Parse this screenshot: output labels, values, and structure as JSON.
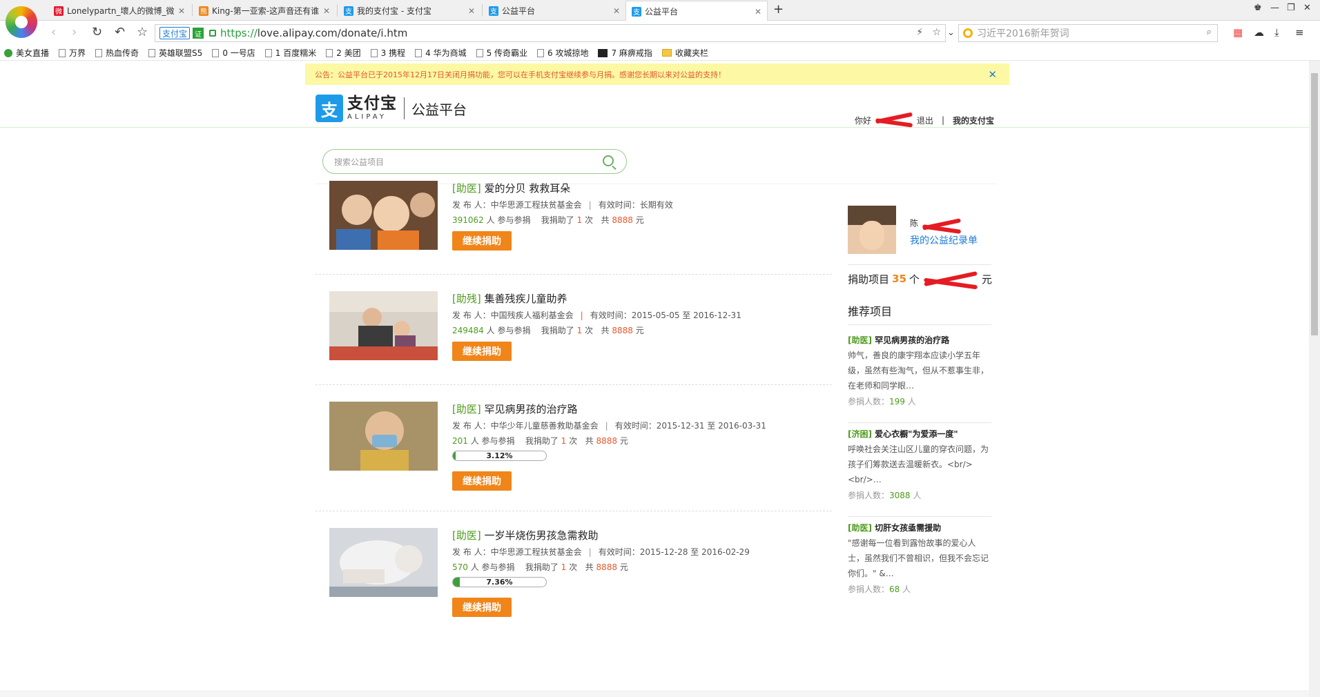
{
  "browser": {
    "tabs": [
      {
        "title": "Lonelypartn_壞人的微博_微",
        "color": "#e6162d",
        "active": false
      },
      {
        "title": "King-第一亚索-这声音还有谁",
        "color": "#f08519",
        "active": false
      },
      {
        "title": "我的支付宝  -  支付宝",
        "color": "#1e9be8",
        "active": false
      },
      {
        "title": "公益平台",
        "color": "#1e9be8",
        "active": false
      },
      {
        "title": "公益平台",
        "color": "#1e9be8",
        "active": true
      }
    ],
    "url_badge": "支付宝",
    "cert_badge": "证",
    "url_scheme": "https://",
    "url_rest": "love.alipay.com/donate/i.htm",
    "search_placeholder": "习近平2016新年贺词",
    "bookmarks": [
      {
        "label": "美女直播",
        "icon": "green-circle-icon"
      },
      {
        "label": "万界",
        "icon": "page-icon"
      },
      {
        "label": "热血传奇",
        "icon": "page-icon"
      },
      {
        "label": "英雄联盟S5",
        "icon": "page-icon"
      },
      {
        "label": "0 一号店",
        "icon": "page-icon"
      },
      {
        "label": "1 百度糯米",
        "icon": "page-icon"
      },
      {
        "label": "2 美团",
        "icon": "page-icon"
      },
      {
        "label": "3 携程",
        "icon": "page-icon"
      },
      {
        "label": "4 华为商城",
        "icon": "page-icon"
      },
      {
        "label": "5 传奇霸业",
        "icon": "page-icon"
      },
      {
        "label": "6 攻城掠地",
        "icon": "page-icon"
      },
      {
        "label": "7 麻痹戒指",
        "icon": "yy-icon"
      },
      {
        "label": "收藏夹栏",
        "icon": "folder-icon"
      }
    ]
  },
  "notice": {
    "text": "公告：公益平台已于2015年12月17日关闭月捐功能，您可以在手机支付宝继续参与月捐。感谢您长期以来对公益的支持！",
    "close": "✕"
  },
  "header": {
    "logo_mark": "支",
    "logo_cn": "支付宝",
    "logo_en": "ALIPAY",
    "subtitle": "公益平台",
    "greeting": "你好",
    "logout": "退出",
    "sep": "|",
    "my_alipay": "我的支付宝"
  },
  "search": {
    "placeholder": "搜索公益项目"
  },
  "projects": [
    {
      "category": "[助医]",
      "title": "爱的分贝 救救耳朵",
      "publisher_label": "发 布 人：",
      "publisher": "中华思源工程扶贫基金会",
      "period_label": "有效时间：",
      "period": "长期有效",
      "participants": "391062",
      "participants_suffix": "人 参与参捐",
      "donated_prefix": "我捐助了",
      "times": "1",
      "times_suffix": "次",
      "total_prefix": "共",
      "amount": "8888",
      "unit": "元",
      "button": "继续捐助",
      "progress": null
    },
    {
      "category": "[助残]",
      "title": "集善残疾儿童助养",
      "publisher_label": "发 布 人：",
      "publisher": "中国残疾人福利基金会",
      "period_label": "有效时间：",
      "period": "2015-05-05 至 2016-12-31",
      "participants": "249484",
      "participants_suffix": "人 参与参捐",
      "donated_prefix": "我捐助了",
      "times": "1",
      "times_suffix": "次",
      "total_prefix": "共",
      "amount": "8888",
      "unit": "元",
      "button": "继续捐助",
      "progress": null
    },
    {
      "category": "[助医]",
      "title": "罕见病男孩的治疗路",
      "publisher_label": "发 布 人：",
      "publisher": "中华少年儿童慈善救助基金会",
      "period_label": "有效时间：",
      "period": "2015-12-31 至 2016-03-31",
      "participants": "201",
      "participants_suffix": "人 参与参捐",
      "donated_prefix": "我捐助了",
      "times": "1",
      "times_suffix": "次",
      "total_prefix": "共",
      "amount": "8888",
      "unit": "元",
      "button": "继续捐助",
      "progress": "3.12%"
    },
    {
      "category": "[助医]",
      "title": "一岁半烧伤男孩急需救助",
      "publisher_label": "发 布 人：",
      "publisher": "中华思源工程扶贫基金会",
      "period_label": "有效时间：",
      "period": "2015-12-28 至 2016-02-29",
      "participants": "570",
      "participants_suffix": "人 参与参捐",
      "donated_prefix": "我捐助了",
      "times": "1",
      "times_suffix": "次",
      "total_prefix": "共",
      "amount": "8888",
      "unit": "元",
      "button": "继续捐助",
      "progress": "7.36%"
    }
  ],
  "sidebar": {
    "name": "陈",
    "record_link": "我的公益纪录单",
    "donated_label": "捐助项目",
    "donated_count": "35",
    "donated_unit": "个",
    "amount_unit": "元",
    "recommend_title": "推荐项目",
    "recommend": [
      {
        "category": "[助医]",
        "title": "罕见病男孩的治疗路",
        "desc": "帅气，善良的康宇翔本应读小学五年级，虽然有些淘气，但从不惹事生非，在老师和同学眼…",
        "count_label": "参捐人数：",
        "count": "199",
        "count_unit": "人"
      },
      {
        "category": "[济困]",
        "title": "爱心衣橱\"为爱添一度\"",
        "desc": "呼唤社会关注山区儿童的穿衣问题，为孩子们筹款送去温暖新衣。<br/><br/>…",
        "count_label": "参捐人数：",
        "count": "3088",
        "count_unit": "人"
      },
      {
        "category": "[助医]",
        "title": "切肝女孩亟需援助",
        "desc": "\"感谢每一位看到露怡故事的爱心人士，虽然我们不曾相识，但我不会忘记你们。\" &…",
        "count_label": "参捐人数：",
        "count": "68",
        "count_unit": "人"
      }
    ]
  }
}
